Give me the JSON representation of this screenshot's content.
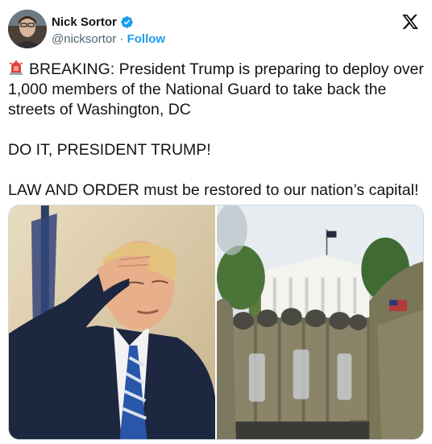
{
  "author": {
    "name": "Nick Sortor",
    "handle": "@nicksortor",
    "separator": " · ",
    "follow_label": "Follow",
    "verified": true
  },
  "icons": {
    "siren": "police-siren-emoji",
    "verified": "verified-badge-icon",
    "logo": "x-logo-icon"
  },
  "colors": {
    "accent": "#1d9bf0",
    "text": "#0f1419",
    "muted": "#536471",
    "border": "#cfd9de"
  },
  "tweet": {
    "line1": "BREAKING: President Trump is preparing to deploy over 1,000 members of the National Guard to take back the streets of Washington, DC",
    "line2": "DO IT, PRESIDENT TRUMP!",
    "line3": "LAW AND ORDER must be restored to our nation’s capital!"
  },
  "media": {
    "count": 2
  }
}
